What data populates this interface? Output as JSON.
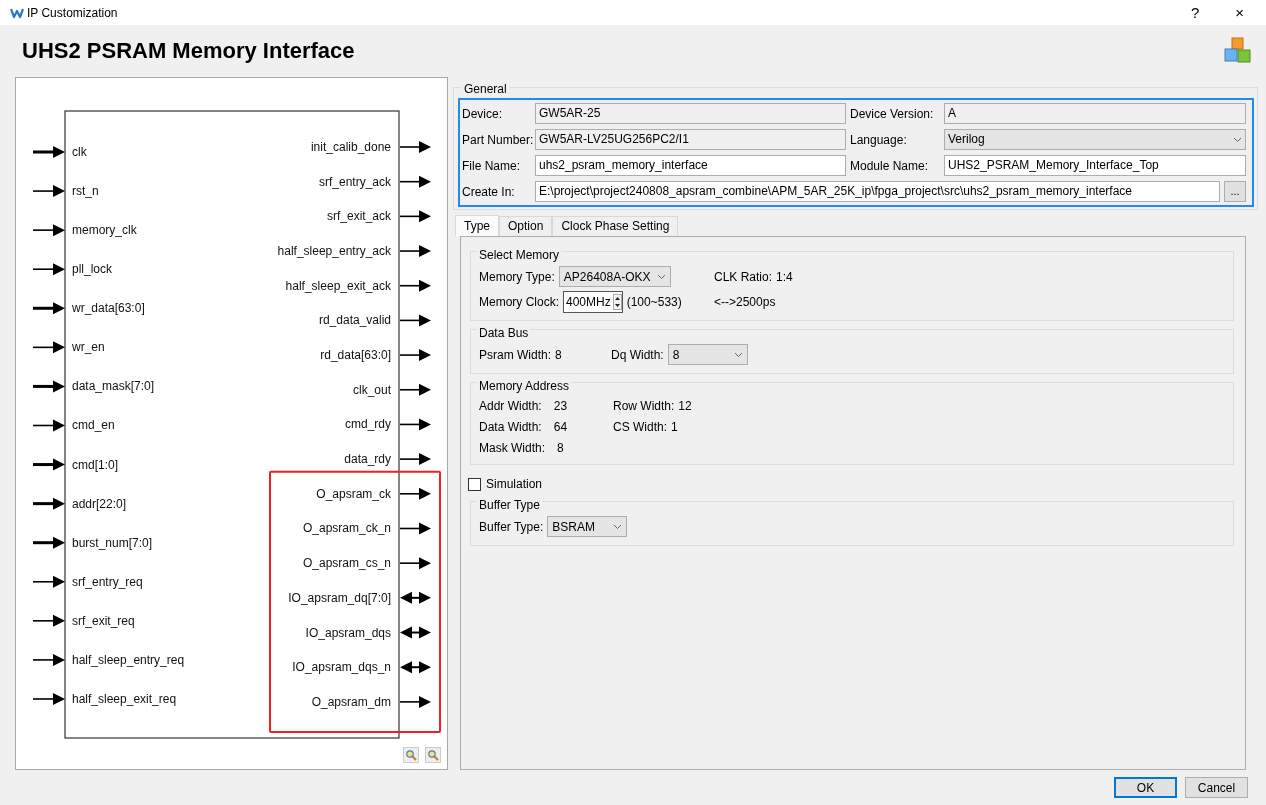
{
  "window": {
    "title": "IP Customization",
    "help": "?",
    "close": "×"
  },
  "heading": "UHS2 PSRAM Memory Interface",
  "diagram": {
    "inputs": [
      {
        "label": "clk",
        "thick": true
      },
      {
        "label": "rst_n",
        "thick": false
      },
      {
        "label": "memory_clk",
        "thick": false
      },
      {
        "label": "pll_lock",
        "thick": false
      },
      {
        "label": "wr_data[63:0]",
        "thick": true
      },
      {
        "label": "wr_en",
        "thick": false
      },
      {
        "label": "data_mask[7:0]",
        "thick": true
      },
      {
        "label": "cmd_en",
        "thick": false
      },
      {
        "label": "cmd[1:0]",
        "thick": true
      },
      {
        "label": "addr[22:0]",
        "thick": true
      },
      {
        "label": "burst_num[7:0]",
        "thick": true
      },
      {
        "label": "srf_entry_req",
        "thick": false
      },
      {
        "label": "srf_exit_req",
        "thick": false
      },
      {
        "label": "half_sleep_entry_req",
        "thick": false
      },
      {
        "label": "half_sleep_exit_req",
        "thick": false
      }
    ],
    "outputs": [
      {
        "label": "init_calib_done",
        "kind": "out"
      },
      {
        "label": "srf_entry_ack",
        "kind": "out"
      },
      {
        "label": "srf_exit_ack",
        "kind": "out"
      },
      {
        "label": "half_sleep_entry_ack",
        "kind": "out"
      },
      {
        "label": "half_sleep_exit_ack",
        "kind": "out"
      },
      {
        "label": "rd_data_valid",
        "kind": "out"
      },
      {
        "label": "rd_data[63:0]",
        "kind": "out"
      },
      {
        "label": "clk_out",
        "kind": "out"
      },
      {
        "label": "cmd_rdy",
        "kind": "out"
      },
      {
        "label": "data_rdy",
        "kind": "out"
      }
    ],
    "highlighted_outputs": [
      {
        "label": "O_apsram_ck",
        "kind": "out"
      },
      {
        "label": "O_apsram_ck_n",
        "kind": "out"
      },
      {
        "label": "O_apsram_cs_n",
        "kind": "out"
      },
      {
        "label": "IO_apsram_dq[7:0]",
        "kind": "inout"
      },
      {
        "label": "IO_apsram_dqs",
        "kind": "inout"
      },
      {
        "label": "IO_apsram_dqs_n",
        "kind": "inout"
      },
      {
        "label": "O_apsram_dm",
        "kind": "out"
      }
    ]
  },
  "general": {
    "title": "General",
    "rows": [
      [
        {
          "label": "Device:",
          "value": "GW5AR-25",
          "kind": "readonly"
        },
        {
          "label": "Device Version:",
          "value": "A",
          "kind": "readonly"
        }
      ],
      [
        {
          "label": "Part Number:",
          "value": "GW5AR-LV25UG256PC2/I1",
          "kind": "readonly"
        },
        {
          "label": "Language:",
          "value": "Verilog",
          "kind": "select"
        }
      ],
      [
        {
          "label": "File Name:",
          "value": "uhs2_psram_memory_interface",
          "kind": "text"
        },
        {
          "label": "Module Name:",
          "value": "UHS2_PSRAM_Memory_Interface_Top",
          "kind": "text"
        }
      ],
      [
        {
          "label": "Create In:",
          "value": "E:\\project\\project240808_apsram_combine\\APM_5AR_25K_ip\\fpga_project\\src\\uhs2_psram_memory_interface",
          "kind": "path",
          "browse": "..."
        }
      ]
    ]
  },
  "tabs": [
    {
      "label": "Type",
      "selected": true
    },
    {
      "label": "Option",
      "selected": false
    },
    {
      "label": "Clock Phase Setting",
      "selected": false
    }
  ],
  "type_panel": [
    {
      "kind": "group",
      "title": "Select Memory",
      "rows": [
        {
          "left": [
            {
              "kind": "text",
              "text": "Memory Type:"
            },
            {
              "kind": "select",
              "value": "AP26408A-OKX"
            }
          ],
          "right": [
            {
              "kind": "text",
              "text": "CLK Ratio:"
            },
            {
              "kind": "text",
              "text": "1:4"
            }
          ]
        },
        {
          "left": [
            {
              "kind": "text",
              "text": "Memory Clock:"
            },
            {
              "kind": "spin",
              "value": "400MHz"
            },
            {
              "kind": "text",
              "text": "(100~533)"
            }
          ],
          "right": [
            {
              "kind": "text",
              "text": "<-->2500ps"
            }
          ]
        }
      ]
    },
    {
      "kind": "group",
      "title": "Data Bus",
      "rows": [
        {
          "left": [
            {
              "kind": "text",
              "text": "Psram Width:"
            },
            {
              "kind": "text",
              "text": "8"
            }
          ],
          "right": [
            {
              "kind": "text",
              "text": "Dq Width:"
            },
            {
              "kind": "select",
              "value": "8"
            }
          ]
        }
      ]
    },
    {
      "kind": "group",
      "title": "Memory Address",
      "rows": [
        {
          "left": [
            {
              "kind": "text",
              "text": "Addr Width:"
            },
            {
              "kind": "text",
              "text": "23"
            }
          ],
          "right": [
            {
              "kind": "text",
              "text": "Row Width:"
            },
            {
              "kind": "text",
              "text": "12"
            }
          ]
        },
        {
          "left": [
            {
              "kind": "text",
              "text": "Data Width:"
            },
            {
              "kind": "text",
              "text": "64"
            }
          ],
          "right": [
            {
              "kind": "text",
              "text": "CS Width:"
            },
            {
              "kind": "text",
              "text": "1"
            }
          ]
        },
        {
          "left": [
            {
              "kind": "text",
              "text": "Mask Width:"
            },
            {
              "kind": "text",
              "text": "8"
            }
          ]
        }
      ]
    },
    {
      "kind": "checkbox",
      "label": "Simulation",
      "checked": false
    },
    {
      "kind": "group",
      "title": "Buffer Type",
      "rows": [
        {
          "left": [
            {
              "kind": "text",
              "text": "Buffer Type:"
            },
            {
              "kind": "select",
              "value": "BSRAM"
            }
          ]
        }
      ]
    }
  ],
  "buttons": [
    {
      "label": "OK",
      "default": true
    },
    {
      "label": "Cancel",
      "default": false
    }
  ]
}
